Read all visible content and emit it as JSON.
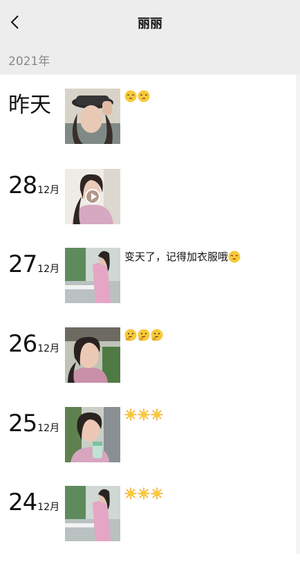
{
  "header": {
    "title": "丽丽",
    "back_icon": "chevron-left-icon"
  },
  "year_label": "2021年",
  "entries": [
    {
      "day": "昨天",
      "month": "",
      "caption": "",
      "emojis": [
        "sleepy-face-icon",
        "sleepy-face-icon"
      ],
      "video": false
    },
    {
      "day": "28",
      "month": "12月",
      "caption": "",
      "emojis": [],
      "video": true
    },
    {
      "day": "27",
      "month": "12月",
      "caption": "变天了，记得加衣服哦",
      "emojis": [
        "sleepy-face-icon"
      ],
      "video": false
    },
    {
      "day": "26",
      "month": "12月",
      "caption": "",
      "emojis": [
        "thinking-face-icon",
        "thinking-face-icon",
        "thinking-face-icon"
      ],
      "video": false
    },
    {
      "day": "25",
      "month": "12月",
      "caption": "",
      "emojis": [
        "sun-icon",
        "sun-icon",
        "sun-icon"
      ],
      "video": false
    },
    {
      "day": "24",
      "month": "12月",
      "caption": "",
      "emojis": [
        "sun-icon",
        "sun-icon",
        "sun-icon"
      ],
      "video": false
    }
  ],
  "colors": {
    "header_bg": "#ededed",
    "year_text": "#888888",
    "emoji_yellow": "#f7c93b",
    "sun_orange": "#f5a623"
  }
}
